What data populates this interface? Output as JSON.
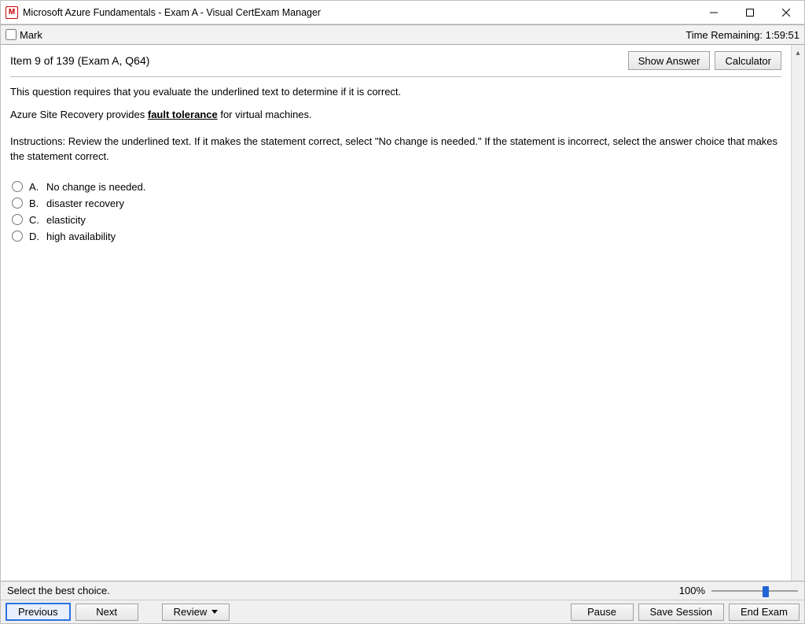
{
  "window": {
    "title": "Microsoft Azure Fundamentals - Exam A - Visual CertExam Manager",
    "app_icon_letter": "M"
  },
  "markbar": {
    "mark_label": "Mark",
    "timer_label": "Time Remaining: 1:59:51"
  },
  "item_header": {
    "label": "Item 9 of 139  (Exam A, Q64)",
    "show_answer": "Show Answer",
    "calculator": "Calculator"
  },
  "question": {
    "intro": "This question requires that you evaluate the underlined text to determine if it is correct.",
    "stmt_pre": "Azure Site Recovery provides ",
    "stmt_underlined": "fault tolerance",
    "stmt_post": " for virtual machines.",
    "instructions": "Instructions: Review the underlined text. If it makes the statement correct, select \"No change is needed.\" If the statement is incorrect, select the answer choice that makes the statement correct."
  },
  "choices": [
    {
      "letter": "A.",
      "text": "No change is needed."
    },
    {
      "letter": "B.",
      "text": "disaster recovery"
    },
    {
      "letter": "C.",
      "text": "elasticity"
    },
    {
      "letter": "D.",
      "text": "high availability"
    }
  ],
  "status": {
    "instruction": "Select the best choice.",
    "zoom": "100%"
  },
  "buttons": {
    "previous": "Previous",
    "next": "Next",
    "review": "Review",
    "pause": "Pause",
    "save_session": "Save Session",
    "end_exam": "End Exam"
  }
}
